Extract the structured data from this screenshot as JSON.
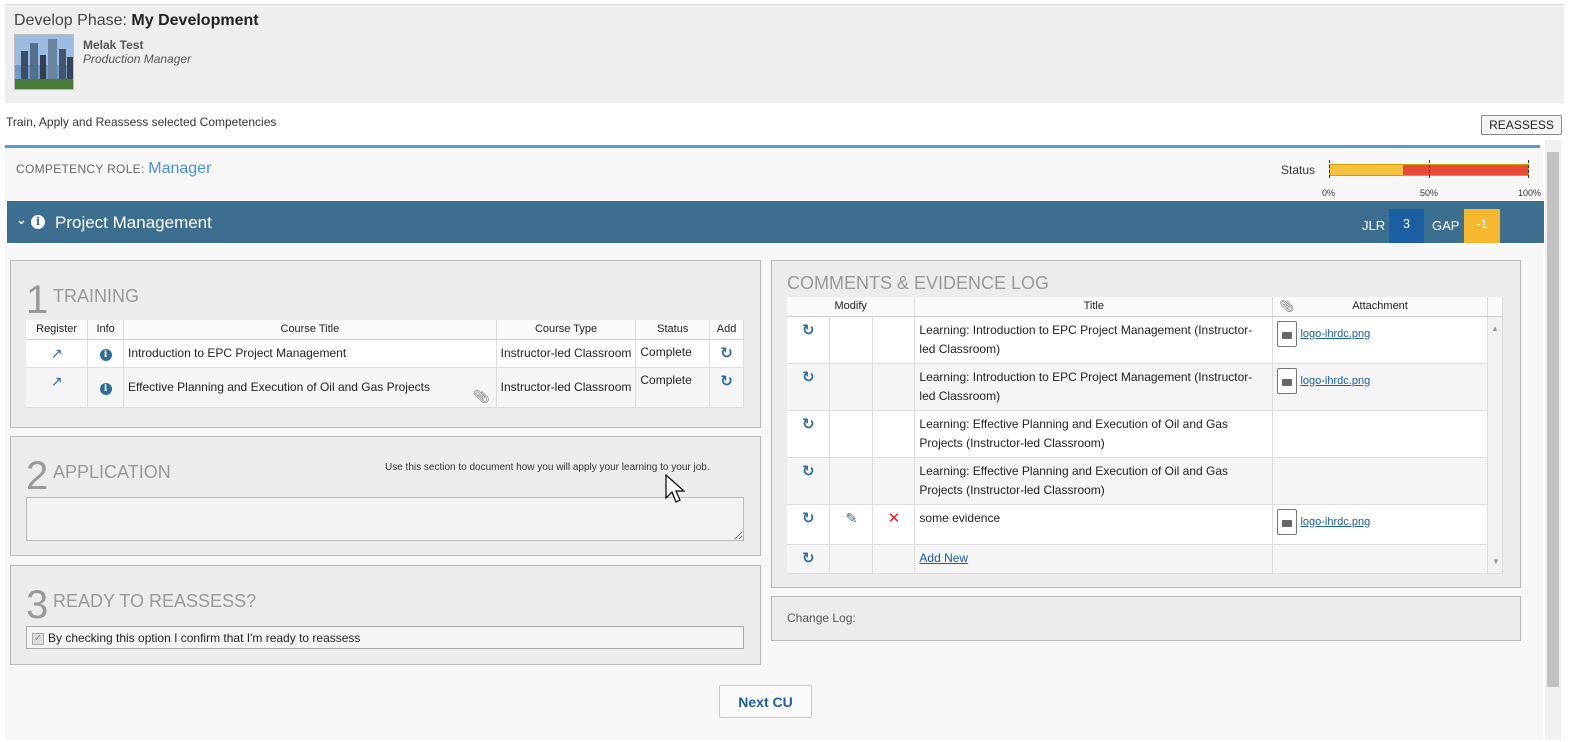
{
  "header": {
    "phase_label": "Develop Phase:",
    "phase_value": "My Development",
    "user_name": "Melak Test",
    "user_role": "Production Manager"
  },
  "subtitle": "Train, Apply and Reassess selected Competencies",
  "reassess_button": "REASSESS",
  "competency_role": {
    "label": "COMPETENCY ROLE:",
    "value": "Manager"
  },
  "status": {
    "label": "Status",
    "progress_fraction": 0.37,
    "ticks": [
      "0%",
      "50%",
      "100%"
    ]
  },
  "competency": {
    "title": "Project Management",
    "jlr_label": "JLR",
    "jlr_value": "3",
    "gap_label": "GAP",
    "gap_value": "-1"
  },
  "training": {
    "number": "1",
    "title": "TRAINING",
    "columns": [
      "Register",
      "Info",
      "Course Title",
      "Course Type",
      "Status",
      "Add"
    ],
    "rows": [
      {
        "course_title": "Introduction to EPC Project Management",
        "course_type": "Instructor-led Classroom",
        "status": "Complete"
      },
      {
        "course_title": "Effective Planning and Execution of Oil and Gas Projects",
        "course_type": "Instructor-led Classroom",
        "status": "Complete"
      }
    ]
  },
  "application": {
    "number": "2",
    "title": "APPLICATION",
    "hint": "Use this section to document how you will apply your learning to your job."
  },
  "ready": {
    "number": "3",
    "title": "READY TO REASSESS?",
    "checkbox_label": "By checking this option I confirm that I'm ready to reassess"
  },
  "comments": {
    "title": "COMMENTS & EVIDENCE LOG",
    "columns": [
      "Modify",
      "Title",
      "Attachment"
    ],
    "rows": [
      {
        "title": "Learning: Introduction to EPC Project Management (Instructor-led Classroom)",
        "attachment": "logo-ihrdc.png"
      },
      {
        "title": "Learning: Introduction to EPC Project Management (Instructor-led Classroom)",
        "attachment": "logo-ihrdc.png"
      },
      {
        "title": "Learning: Effective Planning and Execution of Oil and Gas Projects (Instructor-led Classroom)",
        "attachment": ""
      },
      {
        "title": "Learning: Effective Planning and Execution of Oil and Gas Projects (Instructor-led Classroom)",
        "attachment": ""
      },
      {
        "title": "some evidence",
        "attachment": "logo-ihrdc.png"
      }
    ],
    "add_new": "Add New"
  },
  "change_log_label": "Change Log:",
  "next_button": "Next CU",
  "colors": {
    "accent_blue": "#3c6e8f",
    "jlr_blue": "#1a5ea3",
    "gap_yellow": "#f5b82e",
    "status_red": "#e84a3a",
    "link_blue": "#4a90d9"
  }
}
